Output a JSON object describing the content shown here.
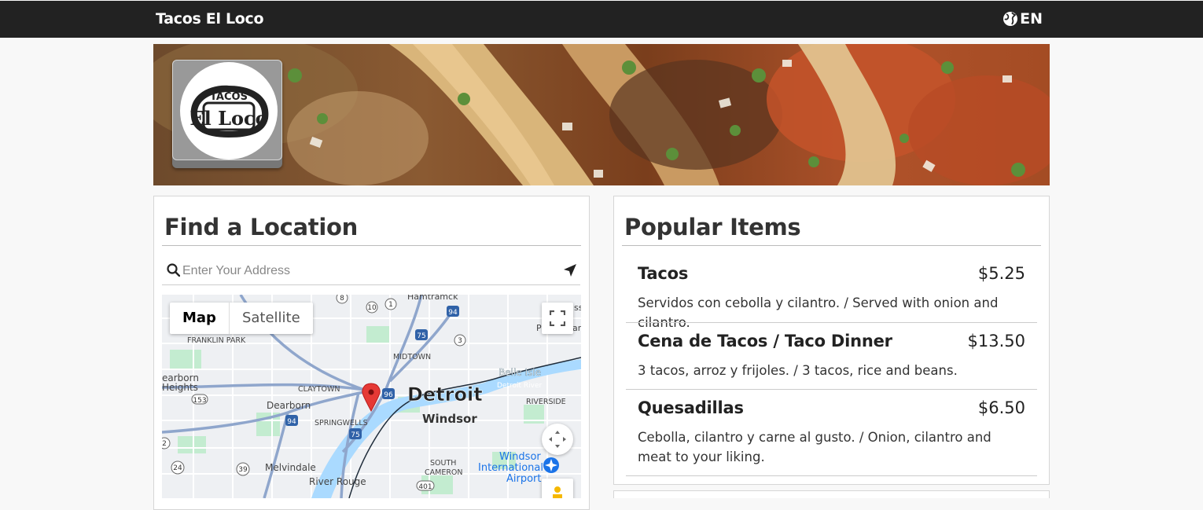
{
  "navbar": {
    "brand": "Tacos El Loco",
    "language": "EN",
    "language_icon": "globe-icon"
  },
  "logo": {
    "text_top": "TACOS",
    "text_main": "El Loco"
  },
  "locator": {
    "title": "Find a Location",
    "search_placeholder": "Enter Your Address",
    "search_icon": "search-icon",
    "locate_icon": "location-arrow-icon",
    "map": {
      "map_type_active": "Map",
      "map_type_other": "Satellite",
      "labels": {
        "detroit": "Detroit",
        "windsor": "Windsor",
        "hamtramck": "Hamtramck",
        "franklin_park": "FRANKLIN PARK",
        "midtown": "MIDTOWN",
        "belle_isle": "Belle Isle",
        "detroit_river": "Detroit River",
        "dearborn_heights_1": "earborn",
        "dearborn_heights_2": "Heights",
        "claytown": "CLAYTOWN",
        "dearborn": "Dearborn",
        "riverside": "RIVERSIDE",
        "springwells": "SPRINGWELLS",
        "south_cameron_1": "SOUTH",
        "south_cameron_2": "CAMERON",
        "melvindale": "Melvindale",
        "river_rouge": "River Rouge",
        "airport_1": "Windsor",
        "airport_2": "International",
        "airport_3": "Airport",
        "grosse_point_fragment": "P",
        "park_fragment": "ark",
        "ss_fragment": "ss"
      },
      "shields": {
        "r8": "8",
        "r10": "10",
        "r1": "1",
        "i94a": "94",
        "i75a": "75",
        "r3": "3",
        "i96": "96",
        "r153": "153",
        "i94b": "94",
        "i75b": "75",
        "r2": "2",
        "r24": "24",
        "r39": "39",
        "r401": "401"
      }
    }
  },
  "popular": {
    "title": "Popular Items",
    "items": [
      {
        "name": "Tacos",
        "price": "$5.25",
        "desc": "Servidos con cebolla y cilantro. / Served with onion and cilantro."
      },
      {
        "name": "Cena de Tacos / Taco Dinner",
        "price": "$13.50",
        "desc": "3 tacos, arroz y frijoles. / 3 tacos, rice and beans."
      },
      {
        "name": "Quesadillas",
        "price": "$6.50",
        "desc": "Cebolla, cilantro y carne al gusto. / Onion, cilantro and meat to your liking."
      }
    ]
  },
  "colors": {
    "navbar_bg": "#222222",
    "page_bg": "#f8f8f8",
    "marker": "#e53935",
    "water": "#aadaff",
    "highway": "#8fa6cc",
    "park": "#c3ecd0"
  }
}
